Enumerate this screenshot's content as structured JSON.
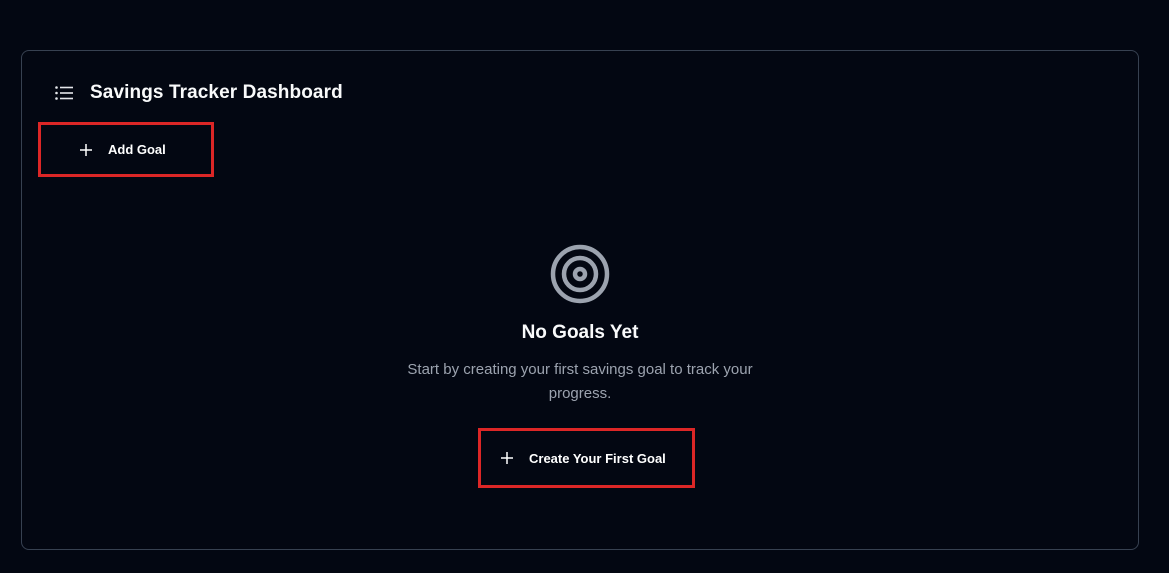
{
  "header": {
    "title": "Savings Tracker Dashboard",
    "icon": "list-icon"
  },
  "toolbar": {
    "add_goal_label": "Add Goal",
    "add_goal_icon": "plus-icon"
  },
  "empty_state": {
    "icon": "target-icon",
    "title": "No Goals Yet",
    "description": "Start by creating your first savings goal to track your progress.",
    "cta_label": "Create Your First Goal",
    "cta_icon": "plus-icon"
  },
  "colors": {
    "background": "#030712",
    "border": "#374151",
    "highlight": "#dc2626",
    "icon_muted": "#9ca3af"
  }
}
